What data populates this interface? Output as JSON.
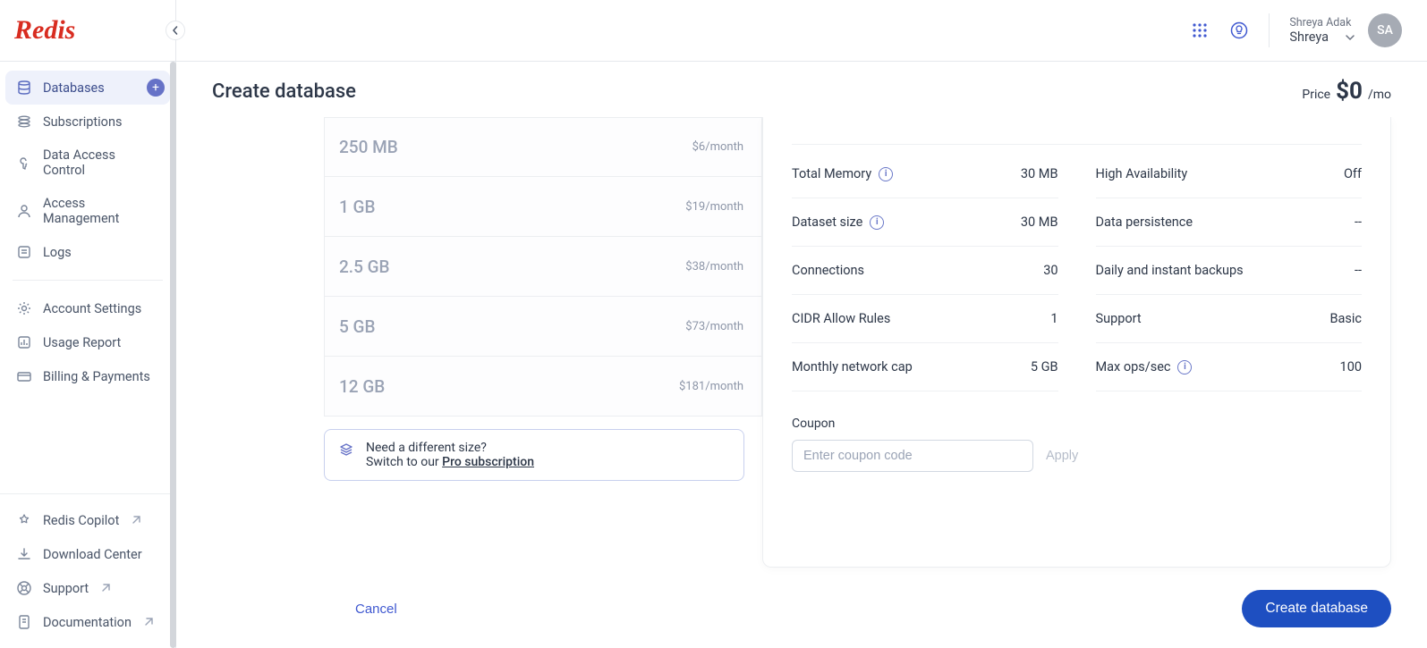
{
  "brand": "Redis",
  "sidebar": {
    "primary": [
      {
        "label": "Databases",
        "active": true,
        "hasAdd": true
      },
      {
        "label": "Subscriptions"
      },
      {
        "label": "Data Access Control"
      },
      {
        "label": "Access Management"
      },
      {
        "label": "Logs"
      }
    ],
    "settings": [
      {
        "label": "Account Settings"
      },
      {
        "label": "Usage Report"
      },
      {
        "label": "Billing & Payments"
      }
    ],
    "links": [
      {
        "label": "Redis Copilot",
        "ext": true
      },
      {
        "label": "Download Center"
      },
      {
        "label": "Support",
        "ext": true
      },
      {
        "label": "Documentation",
        "ext": true
      }
    ]
  },
  "user": {
    "fullName": "Shreya Adak",
    "account": "Shreya",
    "initials": "SA"
  },
  "page": {
    "title": "Create database",
    "price": {
      "label": "Price",
      "amount": "$0",
      "unit": "/mo"
    }
  },
  "tiers": [
    {
      "size": "250 MB",
      "price": "$6/month"
    },
    {
      "size": "1 GB",
      "price": "$19/month"
    },
    {
      "size": "2.5 GB",
      "price": "$38/month"
    },
    {
      "size": "5 GB",
      "price": "$73/month"
    },
    {
      "size": "12 GB",
      "price": "$181/month"
    }
  ],
  "proHint": {
    "line1": "Need a different size?",
    "prefix": "Switch to our ",
    "link": "Pro subscription"
  },
  "details": {
    "left": [
      {
        "label": "Total Memory",
        "value": "30 MB",
        "info": true
      },
      {
        "label": "Dataset size",
        "value": "30 MB",
        "info": true
      },
      {
        "label": "Connections",
        "value": "30"
      },
      {
        "label": "CIDR Allow Rules",
        "value": "1"
      },
      {
        "label": "Monthly network cap",
        "value": "5 GB"
      }
    ],
    "right": [
      {
        "label": "High Availability",
        "value": "Off"
      },
      {
        "label": "Data persistence",
        "value": "--",
        "dash": true
      },
      {
        "label": "Daily and instant backups",
        "value": "--",
        "dash": true
      },
      {
        "label": "Support",
        "value": "Basic"
      },
      {
        "label": "Max ops/sec",
        "value": "100",
        "info": true
      }
    ]
  },
  "coupon": {
    "label": "Coupon",
    "placeholder": "Enter coupon code",
    "apply": "Apply"
  },
  "footer": {
    "cancel": "Cancel",
    "create": "Create database"
  }
}
